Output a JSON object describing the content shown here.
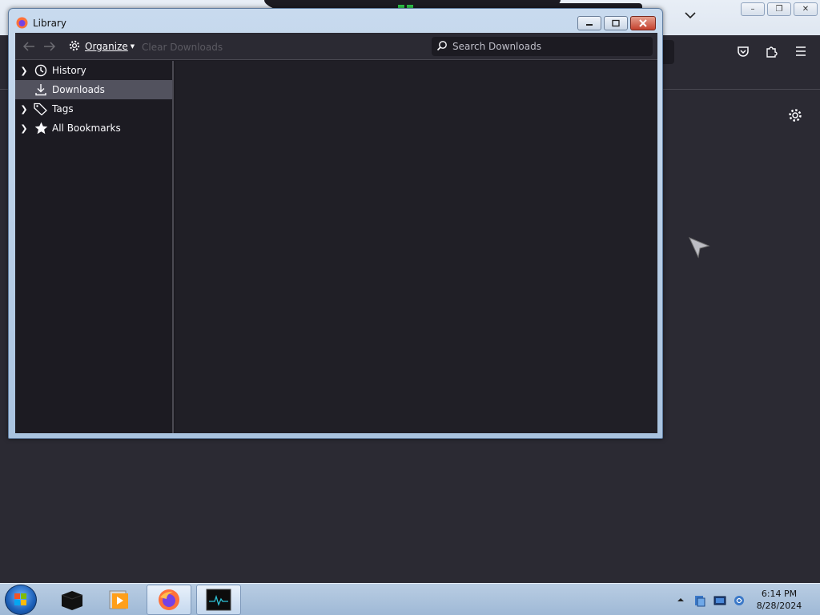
{
  "background_browser": {
    "window_buttons": {
      "minimize": "–",
      "restore": "❐",
      "close": "✕"
    }
  },
  "library": {
    "title": "Library",
    "toolbar": {
      "organize_label": "Organize",
      "clear_downloads_label": "Clear Downloads",
      "search_placeholder": "Search Downloads"
    },
    "sidebar": {
      "items": [
        {
          "label": "History",
          "icon": "clock-icon",
          "expandable": true
        },
        {
          "label": "Downloads",
          "icon": "download-icon",
          "expandable": false,
          "selected": true
        },
        {
          "label": "Tags",
          "icon": "tag-icon",
          "expandable": true
        },
        {
          "label": "All Bookmarks",
          "icon": "star-icon",
          "expandable": true
        }
      ]
    }
  },
  "taskbar": {
    "time": "6:14 PM",
    "date": "8/28/2024"
  },
  "colors": {
    "panel_dark": "#1c1b22",
    "toolbar": "#2b2a33",
    "selected_row": "#52525e",
    "window_frame": "#a9c3df"
  }
}
